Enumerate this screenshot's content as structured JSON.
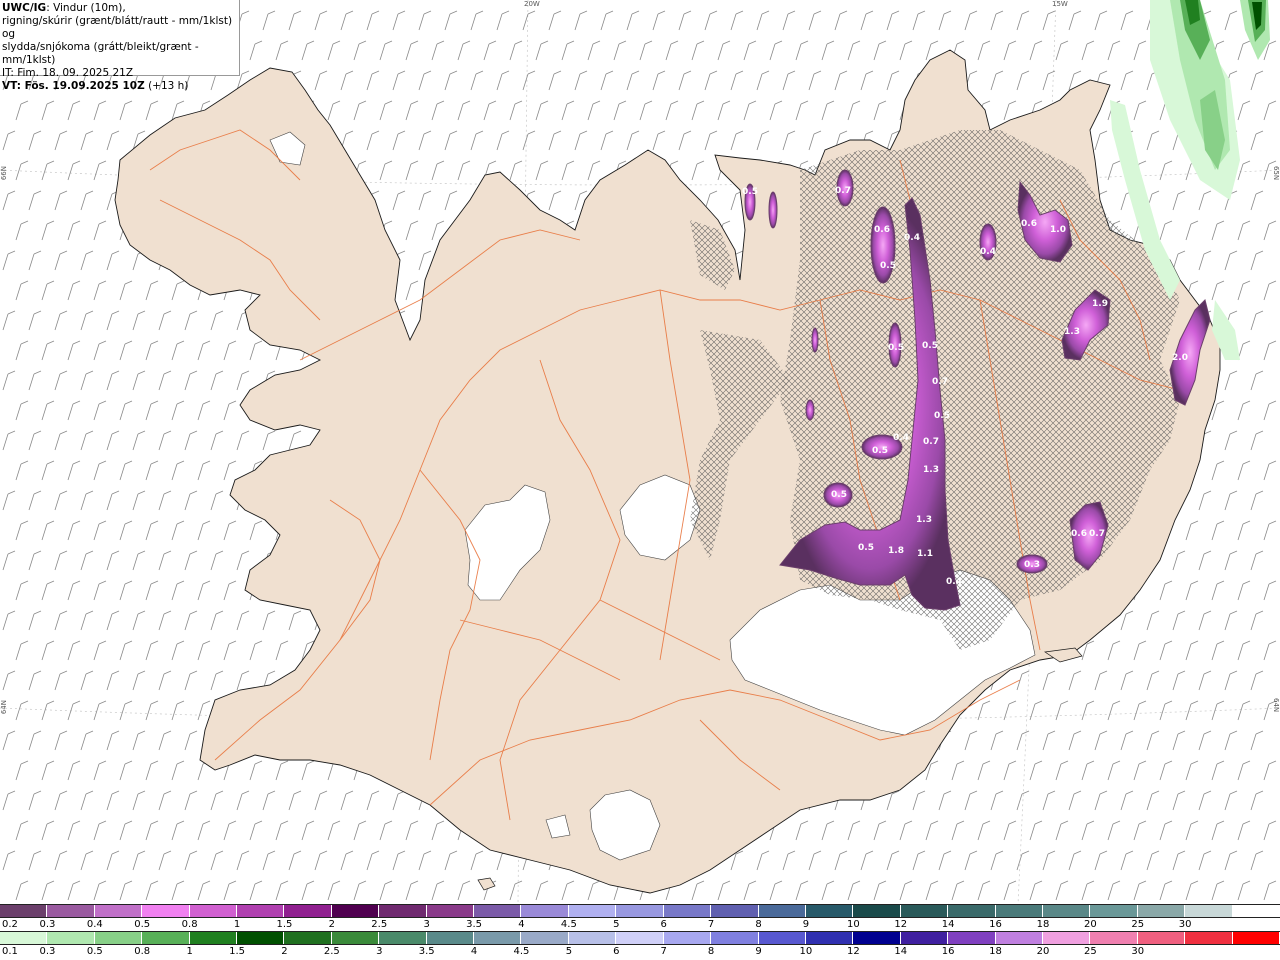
{
  "header": {
    "model": "UWC/IG",
    "line1_rest": ": Vindur (10m),",
    "line2": "rigning/skúrir (grænt/blátt/rautt - mm/1klst) og",
    "line3": "slydda/snjókoma (grátt/bleikt/grænt - mm/1klst)",
    "line4": "IT: Fim. 18. 09. 2025 21Z",
    "line5_bold": "VT: Fös. 19.09.2025 10Z",
    "line5_rest": " (+13 h)"
  },
  "axis_labels": {
    "top_20w": "20W",
    "top_15w": "15W",
    "left_66n": "66N",
    "left_64n": "64N",
    "right_65n": "65N",
    "right_64n": "64N"
  },
  "colors": {
    "land": "#f0e0d0",
    "roads": "#e8743c",
    "coast": "#1a1a1a",
    "glacier": "#ffffff",
    "sea": "#ffffff",
    "wind_barb": "#8a8a8a"
  },
  "precip_labels": [
    {
      "id": "p1",
      "v": "0.7"
    },
    {
      "id": "p2",
      "v": "0.5"
    },
    {
      "id": "p3",
      "v": "0.6"
    },
    {
      "id": "p4",
      "v": "0.4"
    },
    {
      "id": "p5",
      "v": "0.5"
    },
    {
      "id": "p6",
      "v": "0.4"
    },
    {
      "id": "p7",
      "v": "0.6"
    },
    {
      "id": "p8",
      "v": "1.0"
    },
    {
      "id": "p9",
      "v": "1.9"
    },
    {
      "id": "p10",
      "v": "1.3"
    },
    {
      "id": "p11",
      "v": "2.0"
    },
    {
      "id": "p12",
      "v": "0.5"
    },
    {
      "id": "p13",
      "v": "0.5"
    },
    {
      "id": "p14",
      "v": "0.7"
    },
    {
      "id": "p15",
      "v": "0.5"
    },
    {
      "id": "p16",
      "v": "0.4"
    },
    {
      "id": "p17",
      "v": "0.5"
    },
    {
      "id": "p18",
      "v": "0.7"
    },
    {
      "id": "p19",
      "v": "1.3"
    },
    {
      "id": "p20",
      "v": "0.5"
    },
    {
      "id": "p21",
      "v": "1.3"
    },
    {
      "id": "p22",
      "v": "0.5"
    },
    {
      "id": "p23",
      "v": "1.8"
    },
    {
      "id": "p24",
      "v": "1.1"
    },
    {
      "id": "p25",
      "v": "0.4"
    },
    {
      "id": "p26",
      "v": "0.3"
    },
    {
      "id": "p27",
      "v": "0.6"
    },
    {
      "id": "p28",
      "v": "0.7"
    }
  ],
  "legend_snow": {
    "colors": [
      "#6b3f6b",
      "#9a5aa0",
      "#c070c8",
      "#f080f0",
      "#d060d0",
      "#b040b0",
      "#902090",
      "#500050",
      "#702a70",
      "#8a3a8a",
      "#7b5aa8",
      "#9a8ad8",
      "#b0b0f0",
      "#9898e0",
      "#7878c8",
      "#6060b0",
      "#4a6a9a",
      "#285a6a",
      "#1a4a4a",
      "#2a5a5a",
      "#3a6a6a",
      "#4a7a7a",
      "#5a8888",
      "#6a9898",
      "#8aa8a8",
      "#c8d8d8",
      "#ffffff"
    ],
    "labels": [
      "0.2",
      "0.3",
      "0.4",
      "0.5",
      "0.8",
      "1",
      "1.5",
      "2",
      "2.5",
      "3",
      "3.5",
      "4",
      "4.5",
      "5",
      "6",
      "7",
      "8",
      "9",
      "10",
      "12",
      "14",
      "16",
      "18",
      "20",
      "25",
      "30"
    ]
  },
  "legend_rain": {
    "colors": [
      "#d8f8d8",
      "#b0e8b0",
      "#88d088",
      "#58b058",
      "#208020",
      "#005000",
      "#207020",
      "#3a8a3a",
      "#4a8a6a",
      "#5a8a8a",
      "#7a9aaa",
      "#9aaac8",
      "#b8c0e8",
      "#d0d0f8",
      "#a8a8f0",
      "#8080e0",
      "#5858d0",
      "#3030b0",
      "#000090",
      "#4020a0",
      "#8040c0",
      "#c080e0",
      "#f0a0e0",
      "#f080b0",
      "#f06080",
      "#f03040",
      "#ff0000"
    ],
    "labels": [
      "0.1",
      "0.3",
      "0.5",
      "0.8",
      "1",
      "1.5",
      "2",
      "2.5",
      "3",
      "3.5",
      "4",
      "4.5",
      "5",
      "6",
      "7",
      "8",
      "9",
      "10",
      "12",
      "14",
      "16",
      "18",
      "20",
      "25",
      "30"
    ]
  }
}
